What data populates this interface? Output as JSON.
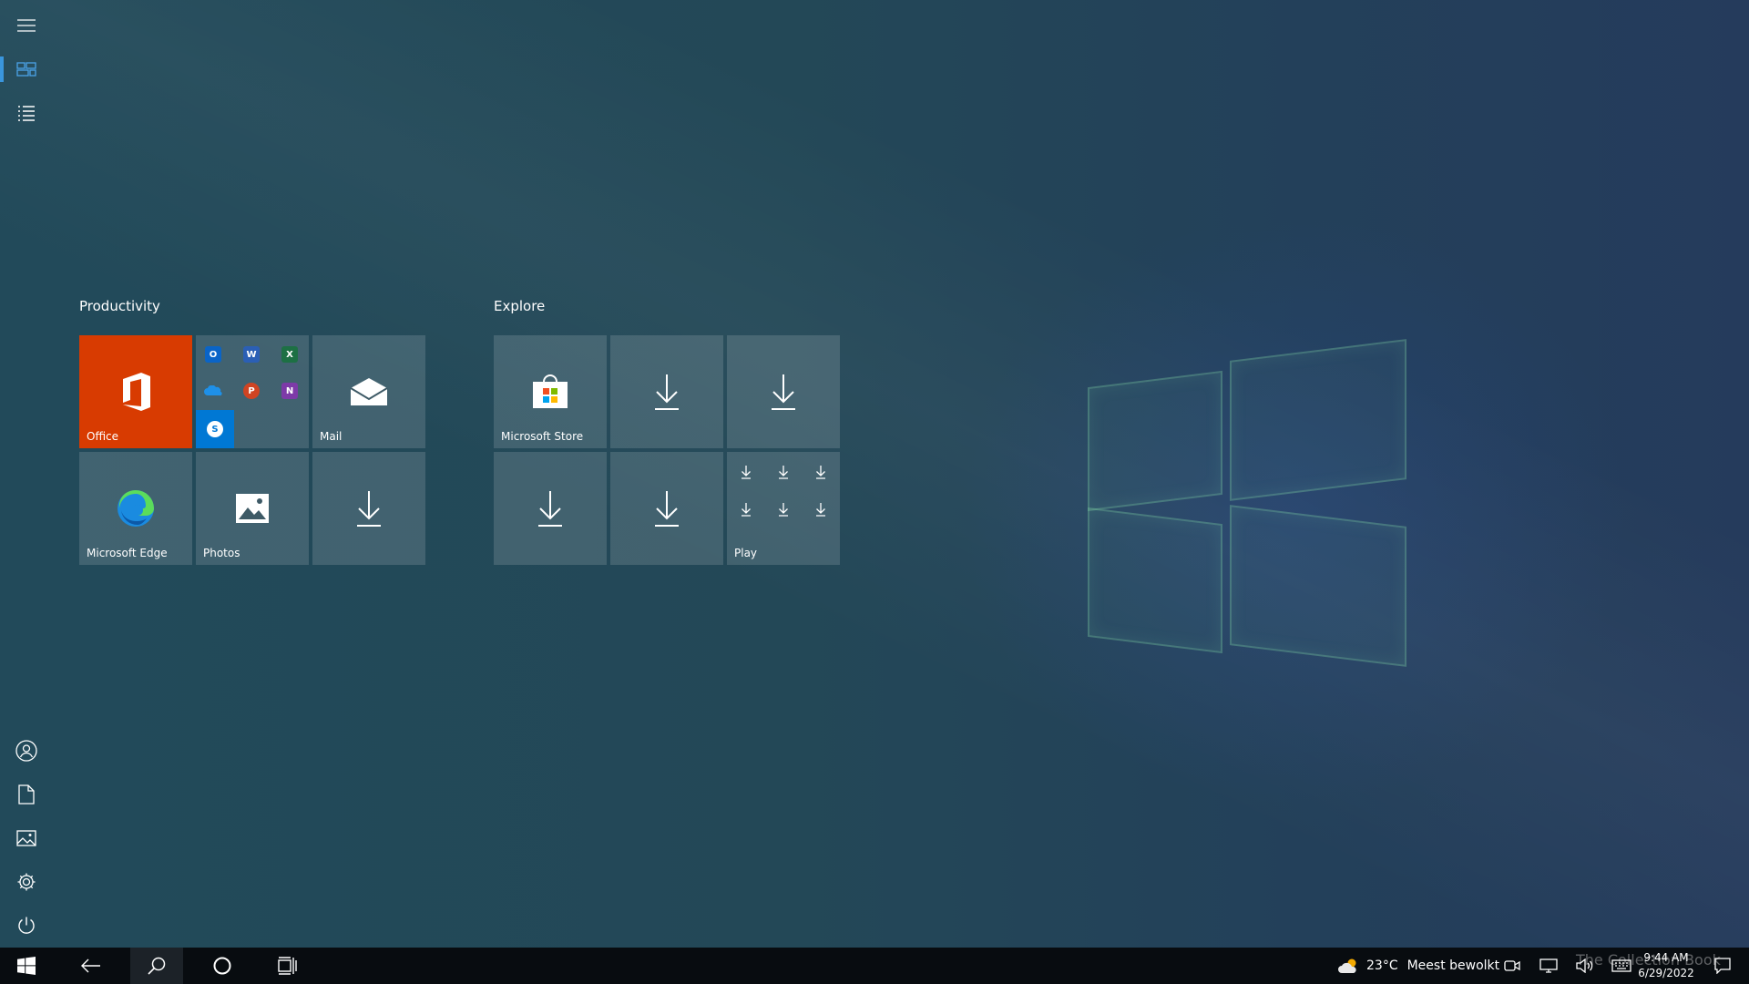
{
  "start": {
    "groups": [
      {
        "title": "Productivity",
        "tiles": [
          {
            "label": "Office",
            "icon": "office-icon"
          },
          {
            "label": "",
            "icon": "office-apps-folder-icon"
          },
          {
            "label": "Mail",
            "icon": "mail-icon"
          },
          {
            "label": "Microsoft Edge",
            "icon": "edge-icon"
          },
          {
            "label": "Photos",
            "icon": "photos-icon"
          },
          {
            "label": "",
            "icon": "download-icon"
          }
        ]
      },
      {
        "title": "Explore",
        "tiles": [
          {
            "label": "Microsoft Store",
            "icon": "store-icon"
          },
          {
            "label": "",
            "icon": "download-icon"
          },
          {
            "label": "",
            "icon": "download-icon"
          },
          {
            "label": "",
            "icon": "download-icon"
          },
          {
            "label": "",
            "icon": "download-icon"
          },
          {
            "label": "Play",
            "icon": "play-folder-icon"
          }
        ]
      }
    ],
    "office_folder_apps": [
      "O",
      "W",
      "X",
      "onedrive",
      "P",
      "N",
      "S"
    ]
  },
  "rail": {
    "top": [
      "hamburger-icon",
      "pinned-tiles-icon",
      "all-apps-icon"
    ],
    "bottom": [
      "user-icon",
      "documents-icon",
      "pictures-icon",
      "settings-icon",
      "power-icon"
    ]
  },
  "taskbar": {
    "weather_temp": "23°C",
    "weather_desc": "Meest bewolkt",
    "time": "9:44 AM",
    "date": "6/29/2022",
    "watermark": "The Collection Book"
  },
  "colors": {
    "office": "#d83b01",
    "skype": "#0078d4",
    "accent": "#3a96dd"
  }
}
